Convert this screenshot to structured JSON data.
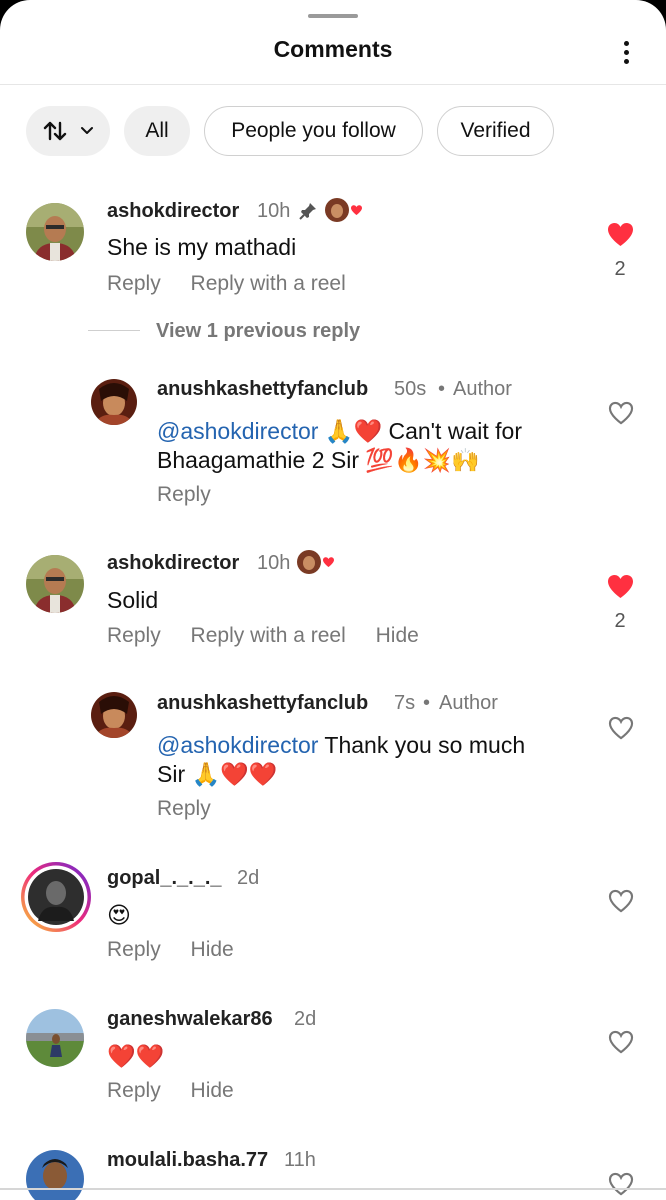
{
  "header": {
    "title": "Comments"
  },
  "filters": {
    "sort_icon": "sort-icon",
    "chips": [
      "All",
      "People you follow",
      "Verified"
    ]
  },
  "comments": [
    {
      "username": "ashokdirector",
      "time": "10h",
      "pinned": true,
      "text": "She is my mathadi",
      "actions": [
        "Reply",
        "Reply with a reel"
      ],
      "liked": true,
      "likes": "2",
      "view_previous": "View 1 previous reply"
    },
    {
      "username": "anushkashettyfanclub",
      "time": "50s",
      "author_label": "Author",
      "mention": "@ashokdirector",
      "text_line1": " 🙏❤️ Can't wait for",
      "text_line2": "Bhaagamathie 2 Sir 💯🔥💥🙌",
      "actions": [
        "Reply"
      ],
      "liked": false
    },
    {
      "username": "ashokdirector",
      "time": "10h",
      "text": "Solid",
      "actions": [
        "Reply",
        "Reply with a reel",
        "Hide"
      ],
      "liked": true,
      "likes": "2"
    },
    {
      "username": "anushkashettyfanclub",
      "time": "7s",
      "author_label": "Author",
      "mention": "@ashokdirector",
      "text_line1": " Thank you so much",
      "text_line2": "Sir 🙏❤️❤️",
      "actions": [
        "Reply"
      ],
      "liked": false
    },
    {
      "username": "gopal_._._._",
      "time": "2d",
      "text": "😍",
      "actions": [
        "Reply",
        "Hide"
      ],
      "liked": false
    },
    {
      "username": "ganeshwalekar86",
      "time": "2d",
      "text": "❤️❤️",
      "actions": [
        "Reply",
        "Hide"
      ],
      "liked": false
    },
    {
      "username": "moulali.basha.77",
      "time": "11h",
      "liked": false
    }
  ],
  "colors": {
    "like_red": "#ff3040",
    "mention_blue": "#2464b0",
    "story_ring": [
      "#f9ce34",
      "#ee2a7b",
      "#6228d7"
    ]
  }
}
